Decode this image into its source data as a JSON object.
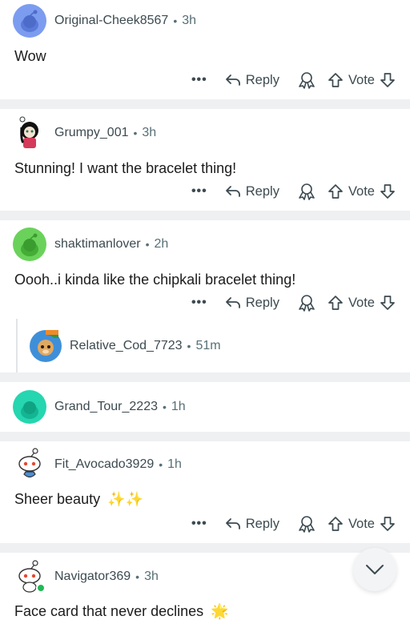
{
  "actions": {
    "more": "•••",
    "reply": "Reply",
    "vote": "Vote"
  },
  "comments": [
    {
      "user": "Original-Cheek8567",
      "time": "3h",
      "text": "Wow"
    },
    {
      "user": "Grumpy_001",
      "time": "3h",
      "text": "Stunning! I want the bracelet thing!"
    },
    {
      "user": "shaktimanlover",
      "time": "2h",
      "text": "Oooh..i kinda like the chipkali bracelet thing!"
    },
    {
      "user": "Relative_Cod_7723",
      "time": "51m",
      "text": ""
    },
    {
      "user": "Grand_Tour_2223",
      "time": "1h",
      "text": ""
    },
    {
      "user": "Fit_Avocado3929",
      "time": "1h",
      "text": "Sheer beauty",
      "emoji": "✨✨"
    },
    {
      "user": "Navigator369",
      "time": "3h",
      "text": "Face card that never declines",
      "emoji": "🌟"
    }
  ],
  "separator_dot": "•",
  "colors": {
    "avatar_blue": "#7c9cf0",
    "avatar_green": "#6ad25a",
    "avatar_teal": "#25d6b0",
    "separator": "#eef0f2",
    "online": "#20b856"
  },
  "icons": {
    "collapse": "chevron-down-icon",
    "award": "award-icon",
    "upvote": "upvote-icon",
    "downvote": "downvote-icon",
    "reply": "reply-arrow-icon"
  }
}
